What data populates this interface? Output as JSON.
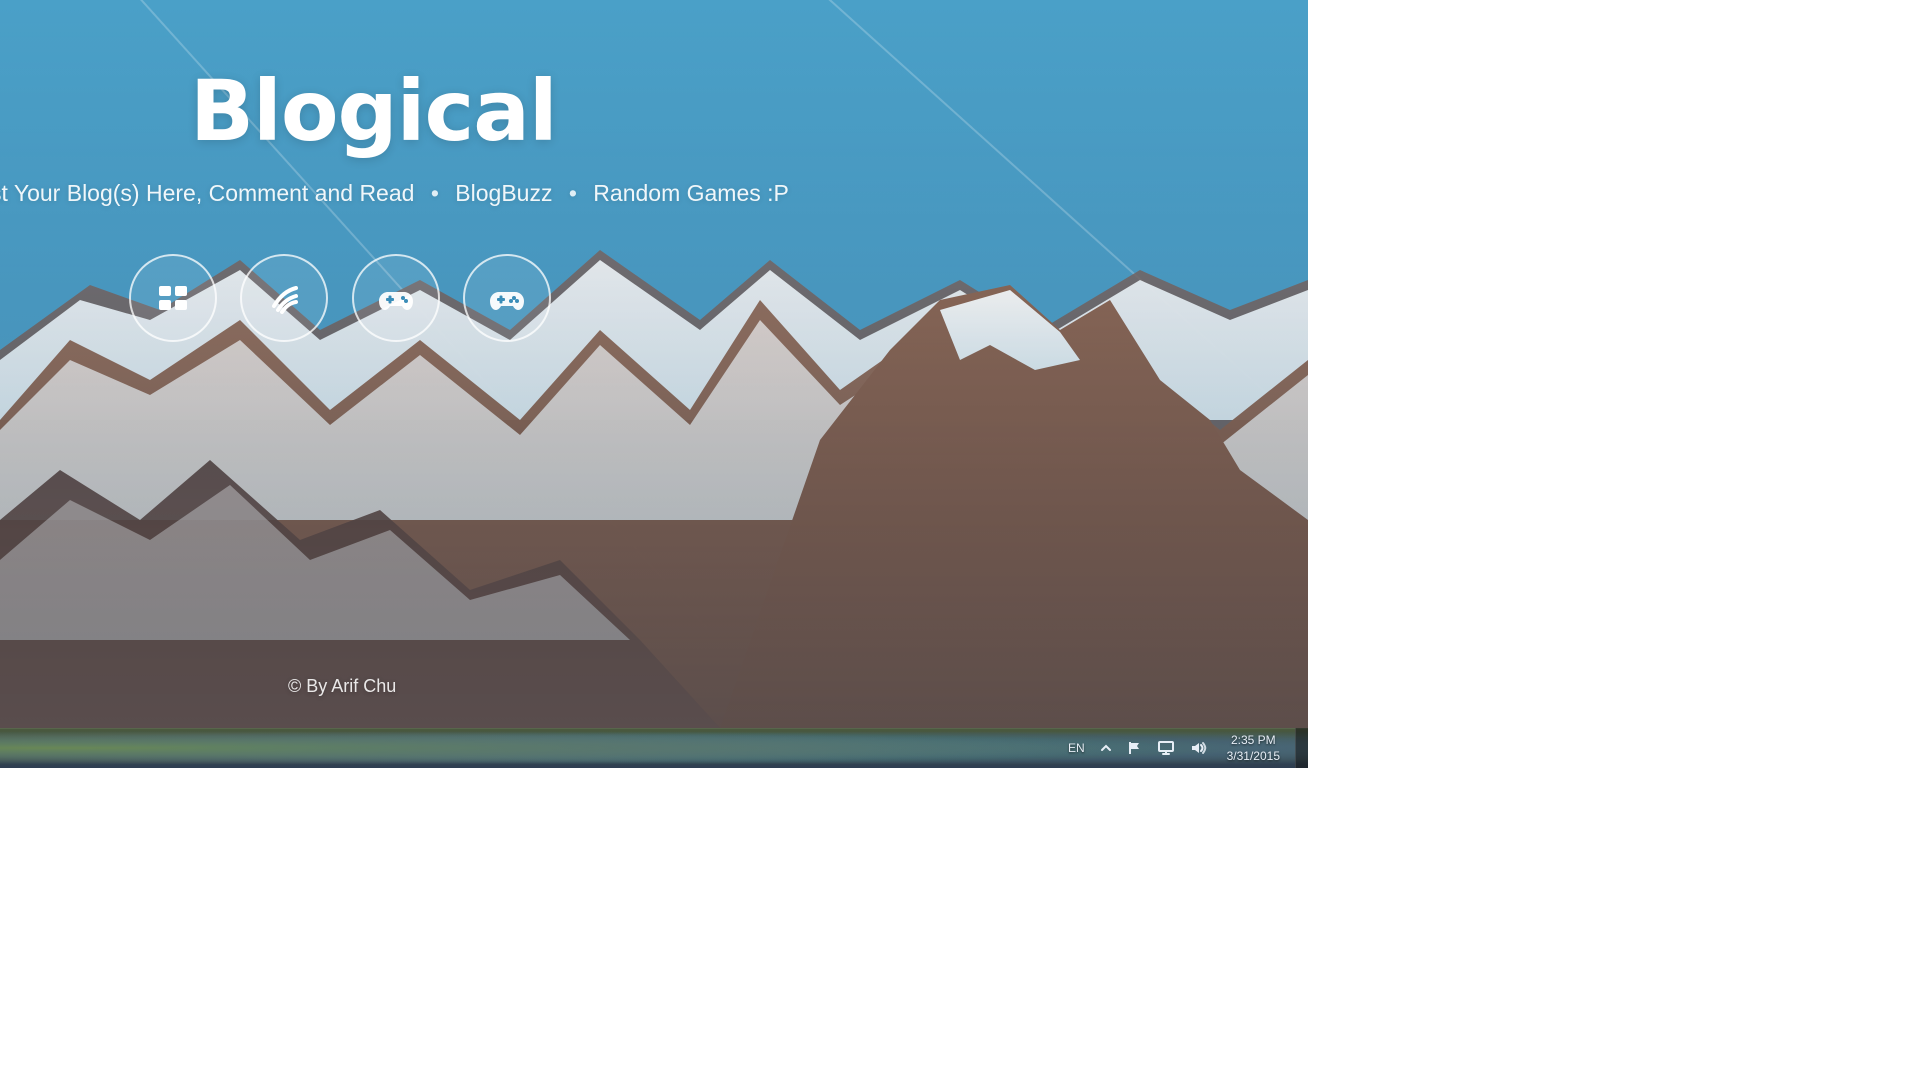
{
  "app": {
    "title": "Blogical",
    "subtitle_items": [
      "st Your Blog(s) Here, Comment and Read",
      "BlogBuzz",
      "Random Games :P"
    ],
    "separator": "•",
    "icons": [
      {
        "name": "windows-tiles-icon"
      },
      {
        "name": "buzz-waves-icon"
      },
      {
        "name": "gamepad-icon"
      },
      {
        "name": "gamepad-2-icon"
      }
    ],
    "copyright": "© By Arif Chu"
  },
  "taskbar": {
    "language": "EN",
    "clock_time": "2:35 PM",
    "clock_date": "3/31/2015",
    "icons": {
      "show_hidden": "chevron-up-icon",
      "action_center": "flag-icon",
      "network": "network-icon",
      "volume": "volume-icon"
    }
  },
  "colors": {
    "sky_top": "#4aa0c8",
    "sky_bottom": "#2f7ea9",
    "title": "#ffffff"
  }
}
